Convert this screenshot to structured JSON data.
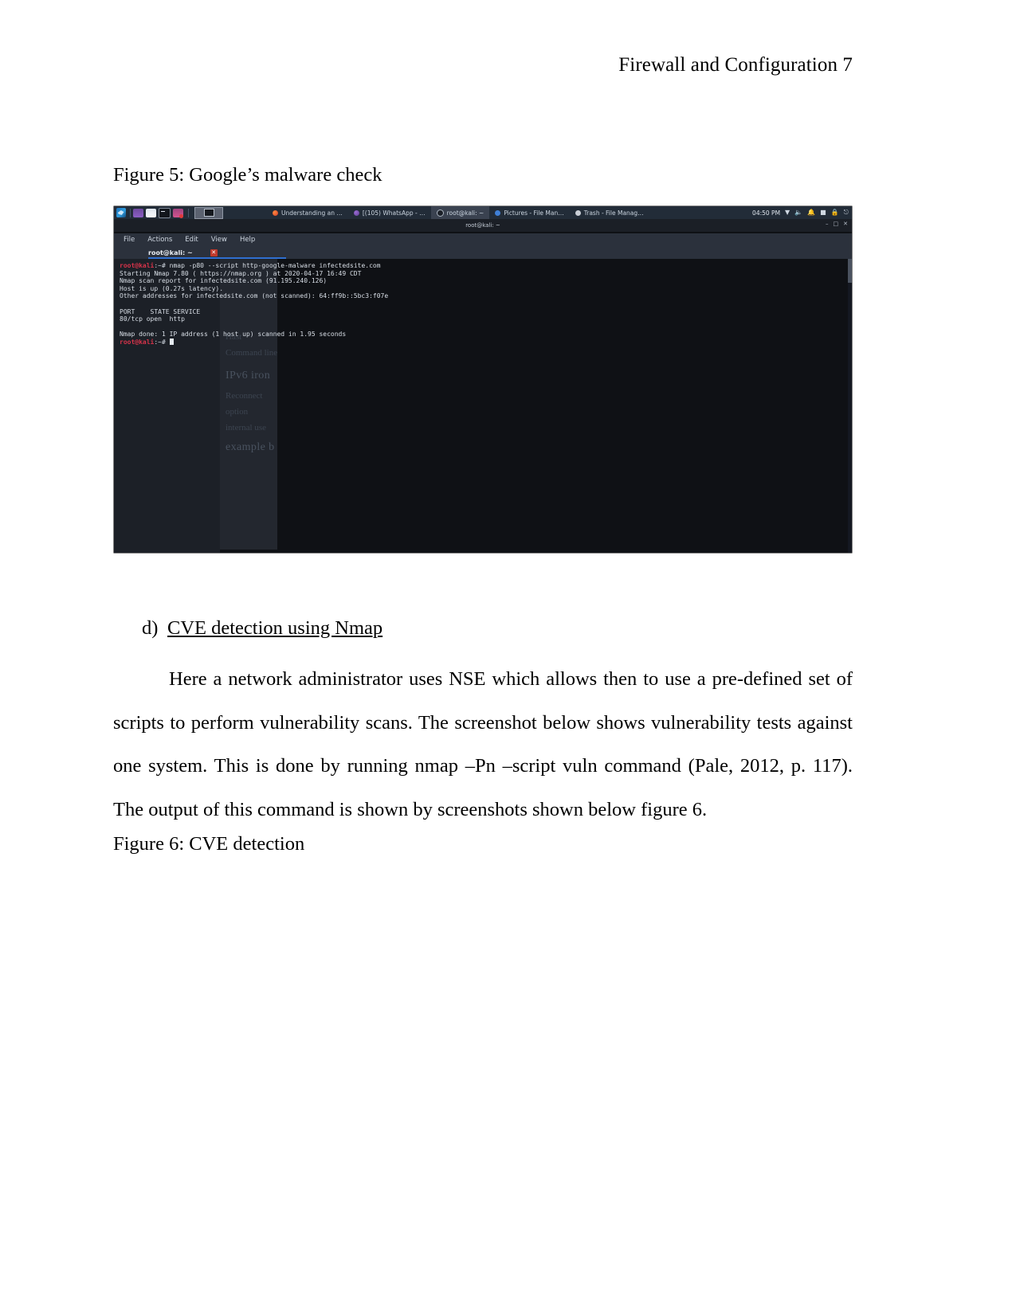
{
  "document": {
    "running_head": "Firewall and Configuration 7",
    "figure5_caption": "Figure 5: Google’s malware check",
    "figure6_caption": "Figure 6: CVE detection",
    "list_item": {
      "marker": "d)",
      "heading": "CVE detection using Nmap"
    },
    "paragraph": "Here a network administrator uses NSE which allows then to use a pre-defined set of scripts to perform vulnerability scans. The screenshot below shows vulnerability tests against one system. This is done by running nmap –Pn –script vuln command (Pale, 2012, p. 117). The output of this command is shown by screenshots shown below figure 6."
  },
  "screenshot": {
    "taskbar": {
      "launcher": "kali-menu-icon",
      "quick_launch": [
        "browser-icon",
        "files-icon",
        "terminal-icon",
        "app-icon"
      ],
      "active_window_preview": "terminal-preview",
      "tasks": [
        {
          "label": "Understanding an …",
          "icon": "firefox-icon",
          "selected": false
        },
        {
          "label": "[(105) WhatsApp - …",
          "icon": "firefox-icon",
          "selected": false
        },
        {
          "label": "root@kali: ~",
          "icon": "terminal-icon",
          "selected": true
        },
        {
          "label": "Pictures - File Man…",
          "icon": "file-manager-icon",
          "selected": false
        },
        {
          "label": "Trash - File Manag…",
          "icon": "trash-icon",
          "selected": false
        }
      ],
      "clock": "04:50 PM",
      "tray_icons": [
        "network-icon",
        "volume-icon",
        "notification-icon",
        "battery-icon",
        "lock-icon",
        "power-icon"
      ]
    },
    "window": {
      "title": "root@kali: ~",
      "controls": {
        "minimize": "–",
        "maximize": "□",
        "close": "✕"
      },
      "menus": [
        {
          "label": "File",
          "accel": "F"
        },
        {
          "label": "Actions",
          "accel": "A"
        },
        {
          "label": "Edit",
          "accel": "E"
        },
        {
          "label": "View",
          "accel": "V"
        },
        {
          "label": "Help",
          "accel": "H"
        }
      ],
      "tab": {
        "label": "root@kali: ~",
        "close": "✕"
      }
    },
    "terminal": {
      "prompt_user": "root@kali",
      "prompt_path": ":~#",
      "command": " nmap -p80 --script http-google-malware infectedsite.com",
      "lines": [
        "Starting Nmap 7.80 ( https://nmap.org ) at 2020-04-17 16:49 CDT",
        "Nmap scan report for infectedsite.com (91.195.240.126)",
        "Host is up (0.27s latency).",
        "Other addresses for infectedsite.com (not scanned): 64:ff9b::5bc3:f07e",
        "",
        "PORT    STATE SERVICE",
        "80/tcp open  http",
        "",
        "Nmap done: 1 IP address (1 host up) scanned in 1.95 seconds"
      ],
      "final_prompt_user": "root@kali",
      "final_prompt_path": ":~#"
    },
    "background_page": {
      "title": "IPv6 iron",
      "lines": [
        "Hast",
        "Command line",
        "Reconnect",
        "option",
        "internal use",
        "example b"
      ]
    }
  },
  "colors": {
    "taskbar_bg": "#222c38",
    "terminal_bg": "#0f1115",
    "prompt_red": "#d7334a",
    "tab_accent": "#2f6fd0",
    "close_red": "#c0392b"
  }
}
